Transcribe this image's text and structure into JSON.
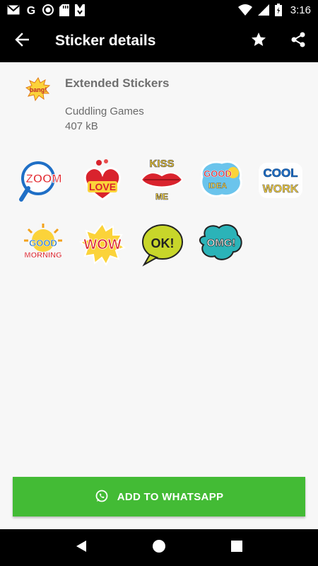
{
  "status_bar": {
    "time": "3:16",
    "left_icons": [
      "gmail-icon",
      "google-icon",
      "circle-record-icon",
      "sd-card-icon",
      "download-icon"
    ],
    "right_icons": [
      "wifi-icon",
      "signal-icon",
      "battery-icon"
    ]
  },
  "app_bar": {
    "title": "Sticker details",
    "back_icon": "arrow-back-icon",
    "actions": [
      "star-icon",
      "share-icon"
    ]
  },
  "pack": {
    "tray_text": "bang!",
    "title": "Extended Stickers",
    "publisher": "Cuddling Games",
    "size": "407 kB"
  },
  "stickers": [
    {
      "name": "zoom",
      "text": "ZOOM"
    },
    {
      "name": "love",
      "text": "LOVE"
    },
    {
      "name": "kiss-me",
      "text_top": "KISS",
      "text_bottom": "ME"
    },
    {
      "name": "good-idea",
      "text_top": "GOOD",
      "text_bottom": "IDEA"
    },
    {
      "name": "cool-work",
      "text_top": "COOL",
      "text_bottom": "WORK"
    },
    {
      "name": "good-morning",
      "text_top": "GOOD",
      "text_bottom": "MORNING"
    },
    {
      "name": "wow",
      "text": "WOW"
    },
    {
      "name": "ok",
      "text": "OK!"
    },
    {
      "name": "omg",
      "text": "OMG!"
    }
  ],
  "add_button": {
    "label": "ADD TO WHATSAPP",
    "icon": "whatsapp-icon",
    "color": "#43bb35"
  },
  "nav_bar": {
    "icons": [
      "back-triangle-icon",
      "home-circle-icon",
      "recents-square-icon"
    ]
  }
}
